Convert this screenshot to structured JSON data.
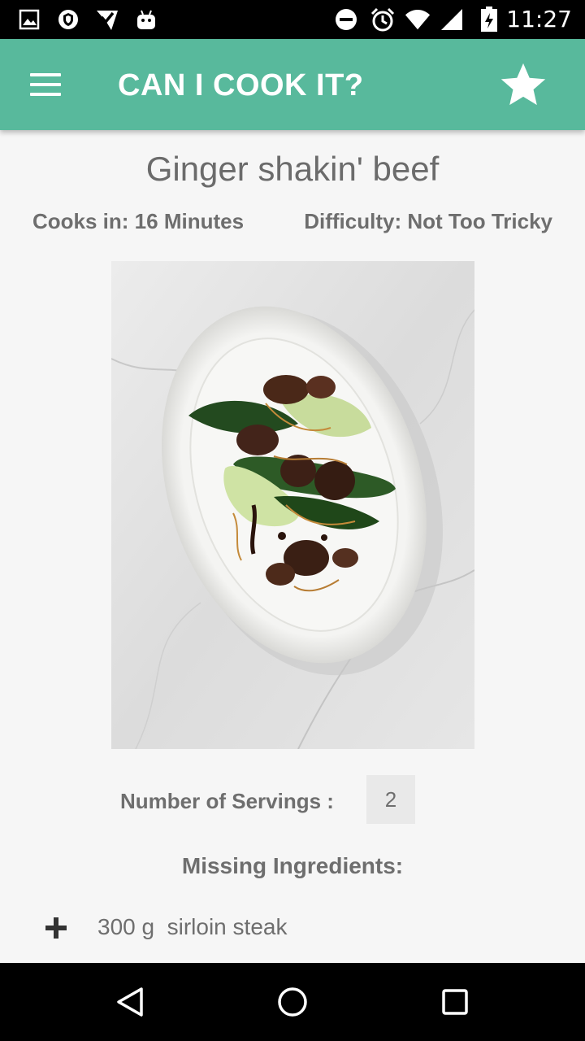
{
  "status_bar": {
    "time": "11:27",
    "left_icons": [
      "gallery-icon",
      "shield-icon",
      "check-icon",
      "android-icon"
    ],
    "right_icons": [
      "do-not-disturb-icon",
      "alarm-icon",
      "wifi-icon",
      "signal-icon",
      "battery-charging-icon"
    ]
  },
  "app_bar": {
    "title": "CAN I COOK IT?",
    "menu_icon": "hamburger-menu-icon",
    "favorite_icon": "star-icon",
    "color": "#58b99c"
  },
  "recipe": {
    "title": "Ginger shakin' beef",
    "cooks_in": "Cooks in: 16 Minutes",
    "difficulty": "Difficulty: Not Too Tricky",
    "image_icon": "recipe-photo"
  },
  "servings": {
    "label": "Number of Servings :",
    "value": "2"
  },
  "missing": {
    "heading": "Missing Ingredients:",
    "items": [
      {
        "text": "300 g  sirloin steak",
        "icon": "plus-icon"
      }
    ]
  },
  "nav_bar": {
    "icons": [
      "back-icon",
      "home-icon",
      "recents-icon"
    ]
  }
}
